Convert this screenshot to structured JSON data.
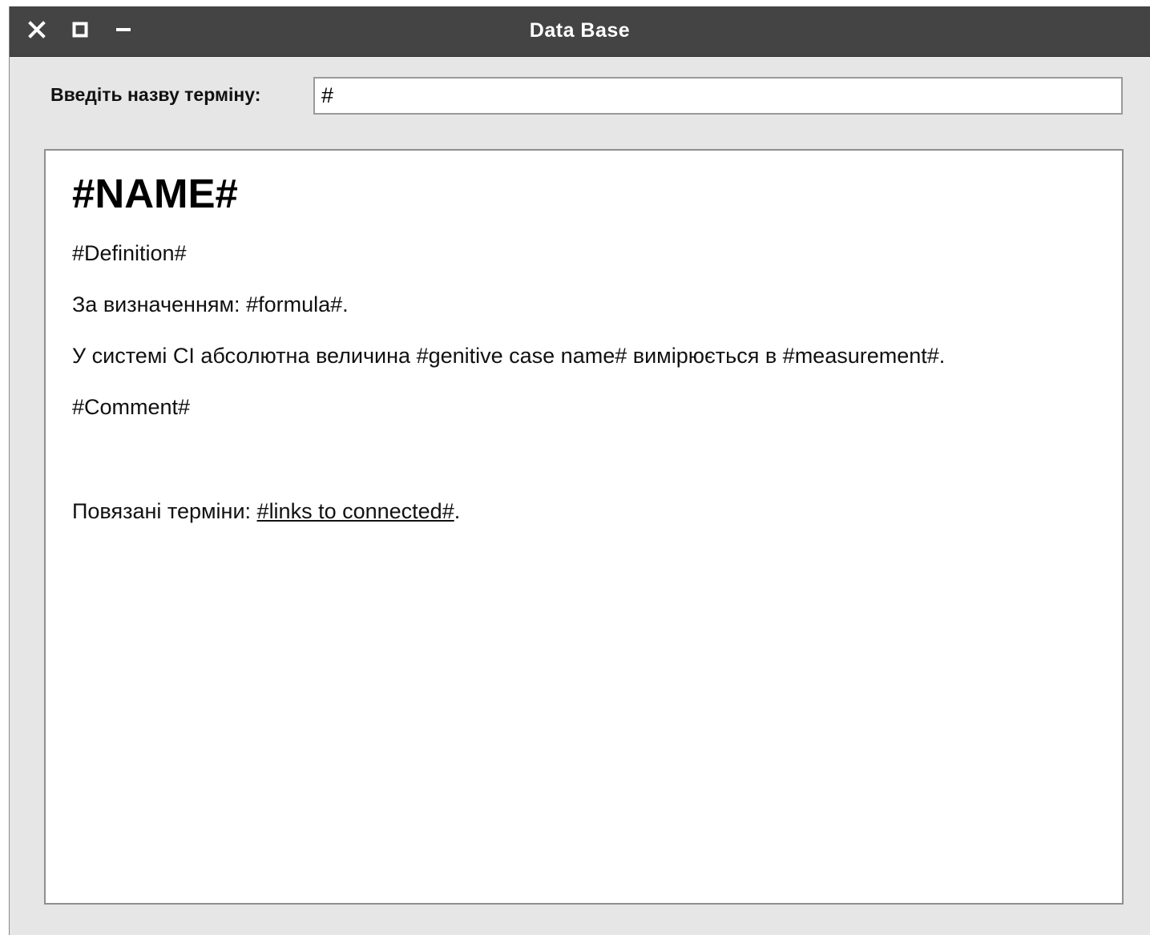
{
  "window": {
    "title": "Data Base",
    "controls": {
      "close_icon": "close-icon",
      "maximize_icon": "maximize-icon",
      "minimize_icon": "minimize-icon"
    }
  },
  "search": {
    "label": "Введіть назву терміну:",
    "value": "#"
  },
  "article": {
    "name": "#NAME#",
    "definition": "#Definition#",
    "formula_prefix": "За визначенням: ",
    "formula": "#formula#",
    "formula_suffix": ".",
    "system_prefix": "У системі СІ абсолютна величина ",
    "genitive_name": "#genitive case name#",
    "system_middle": " вимірюється в ",
    "measurement": "#measurement#",
    "system_suffix": ".",
    "comment": "#Comment#",
    "related_prefix": "Повязані терміни: ",
    "related_link": "#links to connected#",
    "related_suffix": "."
  },
  "colors": {
    "titlebar": "#444444",
    "window_bg": "#e6e6e6",
    "content_bg": "#ffffff",
    "text": "#111111"
  }
}
